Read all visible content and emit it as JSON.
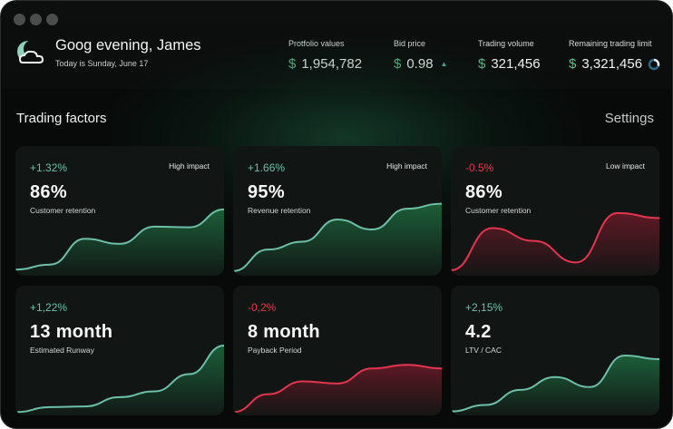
{
  "header": {
    "greeting": "Goog evening, James",
    "date": "Today is Sunday, June 17"
  },
  "stats": [
    {
      "label": "Protfolio values",
      "currency": "$",
      "value": "1,954,782"
    },
    {
      "label": "Bid price",
      "currency": "$",
      "value": "0.98",
      "trend": "up"
    },
    {
      "label": "Trading volume",
      "currency": "$",
      "value": "321,456"
    },
    {
      "label": "Remaining trading limit",
      "currency": "$",
      "value": "3,321,456",
      "limit_used_fraction": 0.3
    }
  ],
  "section": {
    "title": "Trading factors",
    "settings_label": "Settings"
  },
  "colors": {
    "positive": "#6dbfa8",
    "negative": "#e3354f",
    "positive_fill": "#1e6b3f",
    "negative_fill": "#6b1a27",
    "accent_green": "#57c08a"
  },
  "cards": [
    {
      "change": "+1.32%",
      "sign": "pos",
      "impact": "High impact",
      "value": "86%",
      "label": "Customer retention",
      "trend": [
        0.06,
        0.13,
        0.49,
        0.42,
        0.66,
        0.65,
        0.9
      ]
    },
    {
      "change": "+1.66%",
      "sign": "pos",
      "impact": "High impact",
      "value": "95%",
      "label": "Revenue retention",
      "trend": [
        0.04,
        0.34,
        0.45,
        0.76,
        0.62,
        0.91,
        0.98
      ]
    },
    {
      "change": "-0.5%",
      "sign": "neg",
      "impact": "Low impact",
      "value": "86%",
      "label": "Customer retention",
      "trend": [
        0.05,
        0.64,
        0.46,
        0.16,
        0.85,
        0.78
      ]
    },
    {
      "change": "+1,22%",
      "sign": "pos",
      "impact": "",
      "value": "13 month",
      "label": "Estimated Runway",
      "trend": [
        0.02,
        0.09,
        0.1,
        0.23,
        0.31,
        0.55,
        0.95
      ]
    },
    {
      "change": "-0,2%",
      "sign": "neg",
      "impact": "",
      "value": "8 month",
      "label": "Payback Period",
      "trend": [
        0.02,
        0.27,
        0.45,
        0.42,
        0.63,
        0.68,
        0.63
      ]
    },
    {
      "change": "+2,15%",
      "sign": "pos",
      "impact": "",
      "value": "4.2",
      "label": "LTV / CAC",
      "trend": [
        0.03,
        0.12,
        0.33,
        0.51,
        0.37,
        0.81,
        0.76
      ]
    }
  ]
}
